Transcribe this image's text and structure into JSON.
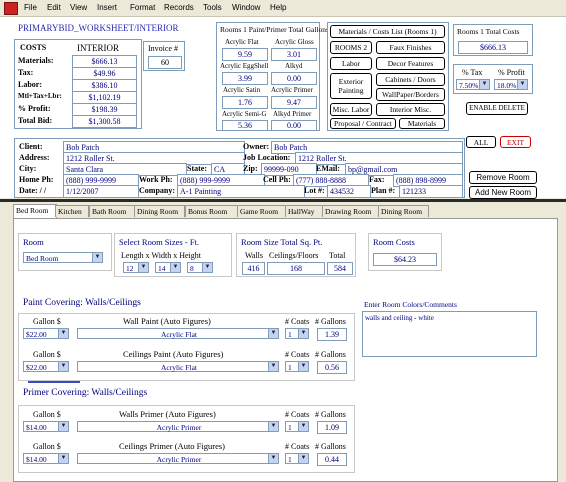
{
  "menu": [
    "File",
    "Edit",
    "View",
    "Insert",
    "Format",
    "Records",
    "Tools",
    "Window",
    "Help"
  ],
  "form_title": "PRIMARYBID_WORKSHEET/INTERIOR",
  "costs": {
    "header_label": "COSTS",
    "header_value": "INTERIOR",
    "rows": [
      {
        "label": "Materials:",
        "value": "$666.13"
      },
      {
        "label": "Tax:",
        "value": "$49.96"
      },
      {
        "label": "Labor:",
        "value": "$386.10"
      },
      {
        "label": "Mtl+Tax+Lbr:",
        "value": "$1,102.19"
      },
      {
        "label": "% Profit:",
        "value": "$198.39"
      },
      {
        "label": "Total Bid:",
        "value": "$1,300.58"
      }
    ]
  },
  "invoice": {
    "label": "Invoice #",
    "value": "60"
  },
  "gallons": {
    "title": "Rooms 1 Paint/Primer Total Gallons",
    "items": [
      {
        "label": "Acrylic Flat",
        "value": "9.59"
      },
      {
        "label": "Acrylic Gloss",
        "value": "3.01"
      },
      {
        "label": "Acrylic EggShell",
        "value": "3.99"
      },
      {
        "label": "Alkyd",
        "value": "0.00"
      },
      {
        "label": "Acrylic Satin",
        "value": "1.76"
      },
      {
        "label": "Acrylic Primer",
        "value": "9.47"
      },
      {
        "label": "Acrylic Semi-G",
        "value": "5.36"
      },
      {
        "label": "Alkyd Primer",
        "value": "0.00"
      }
    ]
  },
  "nav_buttons": {
    "materials_list": "Materials / Costs List (Rooms 1)",
    "rooms2": "ROOMS 2",
    "faux": "Faux Finishes",
    "labor": "Labor",
    "decor": "Decor Features",
    "exterior": "Exterior Painting",
    "cabinets": "Cabinets / Doors",
    "wallpaper": "WallPaper/Borders",
    "misc_labor": "Misc. Labor",
    "interior_misc": "Interior Misc.",
    "proposal": "Proposal / Contract",
    "materials": "Materials"
  },
  "total_costs": {
    "title": "Rooms 1 Total Costs",
    "value": "$666.13"
  },
  "tax_profit": {
    "tax_label": "% Tax",
    "profit_label": "% Profit",
    "tax_value": "7.50%",
    "profit_value": "18.0%"
  },
  "enable_delete": "ENABLE DELETE",
  "all_label": "ALL",
  "exit_label": "EXIT",
  "client": {
    "client_label": "Client:",
    "client": "Bob Patch",
    "owner_label": "Owner:",
    "owner": "Bob Patch",
    "address_label": "Address:",
    "address": "1212 Roller St.",
    "job_label": "Job Location:",
    "job": "1212 Roller St.",
    "city_label": "City:",
    "city": "Santa Clara",
    "state_label": "State:",
    "state": "CA",
    "zip_label": "Zip:",
    "zip": "99999-090",
    "email_label": "EMail:",
    "email": "bp@gmail.com",
    "home_label": "Home Ph:",
    "home": "(888) 999-9999",
    "work_label": "Work Ph:",
    "work": "(888) 999-9999",
    "cell_label": "Cell Ph:",
    "cell": "(777) 888-8888",
    "fax_label": "Fax:",
    "fax": "(888) 898-8999",
    "date_label": "Date: / /",
    "date": "1/12/2007",
    "company_label": "Company:",
    "company": "A-1 Painting",
    "lot_label": "Lot #:",
    "lot": "434532",
    "plan_label": "Plan #:",
    "plan": "121233"
  },
  "remove_room": "Remove Room",
  "add_room": "Add New Room",
  "tabs": [
    "Bed Room",
    "Kitchen",
    "Bath Room",
    "Dining Room",
    "Bonus Room",
    "Game Room",
    "HallWay",
    "Drawing Room",
    "Dining Room"
  ],
  "room": {
    "label": "Room",
    "value": "Bed Room"
  },
  "sizes": {
    "title": "Select Room Sizes - Ft.",
    "dims_label": "Length  x  Width  x  Height",
    "length": "12",
    "width": "14",
    "height": "8"
  },
  "sqft": {
    "title": "Room Size Total Sq. Pt.",
    "walls_label": "Walls",
    "ceil_label": "Ceilings/Floors",
    "total_label": "Total",
    "walls": "416",
    "ceil": "168",
    "total": "584"
  },
  "room_costs": {
    "title": "Room Costs",
    "value": "$64.23"
  },
  "paint": {
    "title": "Paint Covering: Walls/Ceilings",
    "rows": [
      {
        "gallon_label": "Gallon $",
        "price": "$22.00",
        "name": "Wall Paint (Auto Figures)",
        "type": "Acrylic Flat",
        "coats_label": "# Coats",
        "coats": "1",
        "gallons_label": "# Gallons",
        "gallons": "1.39"
      },
      {
        "gallon_label": "Gallon $",
        "price": "$22.00",
        "name": "Ceilings Paint (Auto Figures)",
        "type": "Acrylic Flat",
        "coats_label": "# Coats",
        "coats": "1",
        "gallons_label": "# Gallons",
        "gallons": "0.56"
      }
    ]
  },
  "primer": {
    "title": "Primer Covering: Walls/Ceilings",
    "rows": [
      {
        "gallon_label": "Gallon $",
        "price": "$14.00",
        "name": "Walls Primer (Auto Figures)",
        "type": "Acrylic Primer",
        "coats_label": "# Coats",
        "coats": "1",
        "gallons_label": "# Gallons",
        "gallons": "1.09"
      },
      {
        "gallon_label": "Gallon $",
        "price": "$14.00",
        "name": "Ceilings Primer (Auto Figures)",
        "type": "Acrylic Primer",
        "coats_label": "# Coats",
        "coats": "1",
        "gallons_label": "# Gallons",
        "gallons": "0.44"
      }
    ]
  },
  "comments": {
    "label": "Enter Room Colors/Comments",
    "value": "walls and ceiling - white"
  },
  "colors": {
    "accent": "#000080",
    "exit": "#cc0000",
    "title": "#2a2ab0"
  }
}
